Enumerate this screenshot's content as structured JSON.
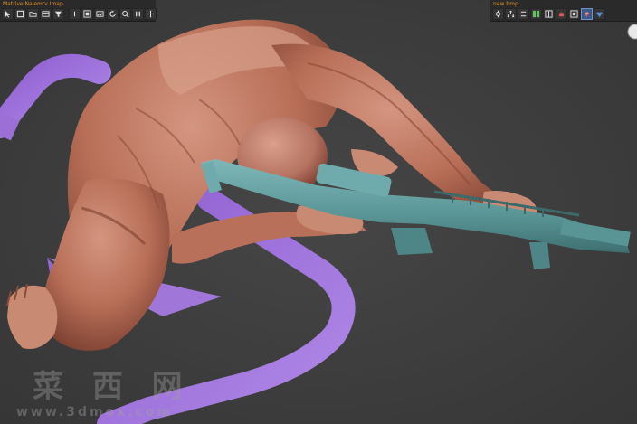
{
  "viewport": {
    "background": "#3f3f3f",
    "scene": {
      "figure": "muscle-anatomy-figure",
      "prop": "sniper-rifle-model",
      "gizmo": "purple-path-spline"
    }
  },
  "left_toolbar": {
    "title": "Matrive Nalemtv Imap",
    "buttons": [
      {
        "name": "select-object",
        "icon": "arrow-icon"
      },
      {
        "name": "select-region",
        "icon": "square-icon"
      },
      {
        "name": "open",
        "icon": "folder-icon"
      },
      {
        "name": "transform",
        "icon": "window-icon"
      },
      {
        "name": "modify",
        "icon": "filter-icon"
      },
      {
        "name": "link",
        "icon": "link-icon"
      },
      {
        "name": "view",
        "icon": "frame-icon"
      },
      {
        "name": "render",
        "icon": "picture-icon"
      },
      {
        "name": "rotate",
        "icon": "rotate-icon"
      },
      {
        "name": "scale",
        "icon": "magnifier-icon"
      },
      {
        "name": "snap",
        "icon": "snap-icon"
      },
      {
        "name": "pan",
        "icon": "move-icon"
      }
    ]
  },
  "right_toolbar": {
    "title": "new bmp",
    "buttons": [
      {
        "name": "render-setup",
        "icon": "gear-icon"
      },
      {
        "name": "hierarchy",
        "icon": "hierarchy-icon"
      },
      {
        "name": "list",
        "icon": "list-icon"
      },
      {
        "name": "grid",
        "icon": "grid-icon"
      },
      {
        "name": "material",
        "icon": "material-icon"
      },
      {
        "name": "teapot",
        "icon": "teapot-icon"
      },
      {
        "name": "render-frame",
        "icon": "render-frame-icon",
        "active": true
      },
      {
        "name": "environment",
        "icon": "environment-icon"
      },
      {
        "name": "effects",
        "icon": "effects-icon"
      }
    ]
  },
  "watermark": {
    "chinese": "菜 西 网",
    "url": "www.3dmox.com"
  },
  "colors": {
    "skin": "#c07a62",
    "skin_shadow": "#8a4a38",
    "rifle": "#5f9ea0",
    "spline": "#9b6fd6",
    "toolbar_bg": "#2a2a2a",
    "title_orange": "#d9902e"
  }
}
